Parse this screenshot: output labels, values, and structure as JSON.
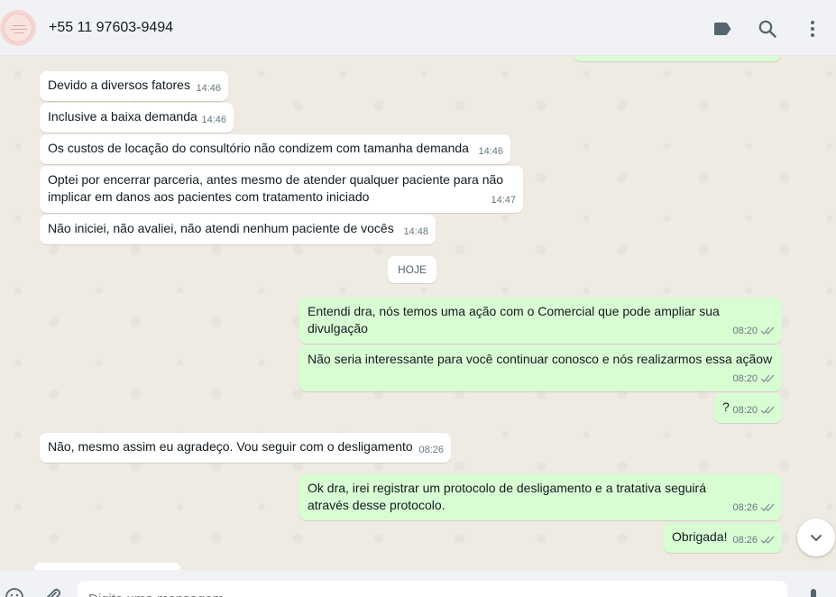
{
  "header": {
    "contact_name": "+55 11 97603-9494",
    "icons": [
      "label-icon",
      "search-icon",
      "menu-icon"
    ]
  },
  "messages": [
    {
      "direction": "in",
      "text": "Devido a diversos fatores",
      "time": "14:46"
    },
    {
      "direction": "in",
      "text": "Inclusive a baixa demanda",
      "time": "14:46"
    },
    {
      "direction": "in",
      "text": "Os custos de locação do consultório não condizem com tamanha demanda",
      "time": "14:46"
    },
    {
      "direction": "in",
      "text": "Optei por encerrar parceria, antes mesmo de atender qualquer paciente para não implicar em danos aos pacientes com tratamento iniciado",
      "time": "14:47"
    },
    {
      "direction": "in",
      "text": "Não iniciei,  não avaliei, não atendi nenhum paciente de vocês",
      "time": "14:48"
    },
    {
      "direction": "out",
      "text": "Entendi dra, nós temos uma ação com o Comercial que pode ampliar sua divulgação",
      "time": "08:20"
    },
    {
      "direction": "out",
      "text": "Não seria interessante para você continuar conosco e nós realizarmos essa açãow",
      "time": "08:20"
    },
    {
      "direction": "out",
      "text": "?",
      "time": "08:20"
    },
    {
      "direction": "in",
      "text": "Não, mesmo assim eu agradeço. Vou seguir com o desligamento",
      "time": "08:26"
    },
    {
      "direction": "out",
      "text": "Ok dra, irei registrar um protocolo de desligamento e a tratativa seguirá através desse protocolo.",
      "time": "08:26"
    },
    {
      "direction": "out",
      "text": "Obrigada!",
      "time": "08:26"
    }
  ],
  "day_separator": "HOJE",
  "composer": {
    "placeholder": "Digite uma mensagem"
  },
  "colors": {
    "incoming": "#ffffff",
    "outgoing": "#d9fdd3",
    "ticks": "#8696a0"
  }
}
